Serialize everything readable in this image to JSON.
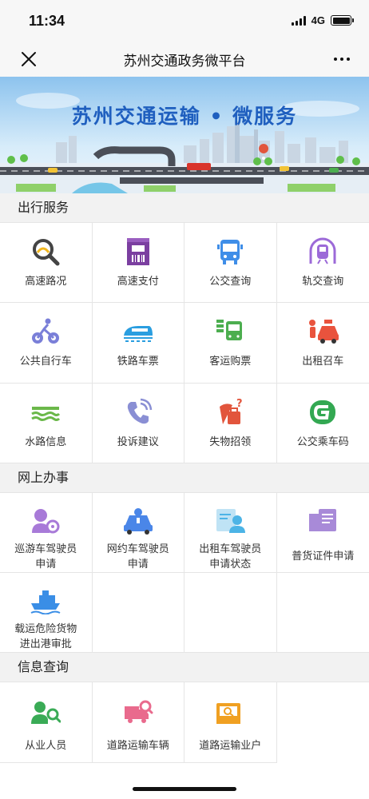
{
  "status": {
    "time": "11:34",
    "network": "4G"
  },
  "nav": {
    "title": "苏州交通政务微平台"
  },
  "banner": {
    "title": "苏州交通运输 • 微服务"
  },
  "sections": [
    {
      "title": "出行服务",
      "items": [
        {
          "label": "高速路况",
          "icon": "highway-search-icon",
          "color": "#444444"
        },
        {
          "label": "高速支付",
          "icon": "toll-ticket-icon",
          "color": "#7b3fa0"
        },
        {
          "label": "公交查询",
          "icon": "bus-icon",
          "color": "#3f8ee8"
        },
        {
          "label": "轨交查询",
          "icon": "metro-icon",
          "color": "#9c6ad8"
        },
        {
          "label": "公共自行车",
          "icon": "bicycle-icon",
          "color": "#7a7fd8"
        },
        {
          "label": "铁路车票",
          "icon": "train-icon",
          "color": "#2a9ee0"
        },
        {
          "label": "客运购票",
          "icon": "coach-icon",
          "color": "#4cae4f"
        },
        {
          "label": "出租召车",
          "icon": "taxi-icon",
          "color": "#e9533d"
        },
        {
          "label": "水路信息",
          "icon": "waterway-icon",
          "color": "#6bb84a"
        },
        {
          "label": "投诉建议",
          "icon": "phone-complaint-icon",
          "color": "#8a8fd4"
        },
        {
          "label": "失物招领",
          "icon": "lost-found-icon",
          "color": "#e2553c"
        },
        {
          "label": "公交乘车码",
          "icon": "bus-code-icon",
          "color": "#33a852"
        }
      ]
    },
    {
      "title": "网上办事",
      "items": [
        {
          "label": "巡游车驾驶员\n申请",
          "icon": "taxi-driver-icon",
          "color": "#a87ad8"
        },
        {
          "label": "网约车驾驶员\n申请",
          "icon": "ride-hail-driver-icon",
          "color": "#4a86e8"
        },
        {
          "label": "出租车驾驶员\n申请状态",
          "icon": "driver-status-icon",
          "color": "#4cb4e6"
        },
        {
          "label": "普货证件申请",
          "icon": "freight-license-icon",
          "color": "#a88ad8"
        },
        {
          "label": "载运危险货物\n进出港审批",
          "icon": "hazard-ship-icon",
          "color": "#3a8ee6"
        }
      ]
    },
    {
      "title": "信息查询",
      "items": [
        {
          "label": "从业人员",
          "icon": "staff-search-icon",
          "color": "#3aab56"
        },
        {
          "label": "道路运输车辆",
          "icon": "vehicle-search-icon",
          "color": "#e96a8d"
        },
        {
          "label": "道路运输业户",
          "icon": "business-search-icon",
          "color": "#f0a022"
        }
      ]
    }
  ]
}
